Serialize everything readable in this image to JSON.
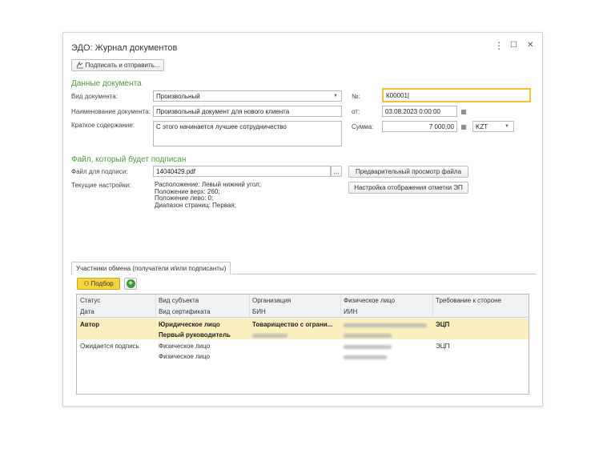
{
  "window": {
    "title": "ЭДО: Журнал документов",
    "more_icon": "⋮",
    "maximize_icon": "☐",
    "close_icon": "✕"
  },
  "toolbar": {
    "sign_send_label": "Подписать и отправить..."
  },
  "doc": {
    "section_title": "Данные документа",
    "type_label": "Вид документа:",
    "type_value": "Произвольный",
    "name_label": "Наименование документа:",
    "name_value": "Произвольный документ для нового клиента",
    "summary_label": "Краткое содержание:",
    "summary_value": "С этого начинается лучшее сотрудничество",
    "number_label": "№:",
    "number_value": "К00001",
    "date_label": "от:",
    "date_value": "03.08.2023 0:00:00",
    "sum_label": "Сумма:",
    "sum_value": "7 000,00",
    "currency_value": "KZT"
  },
  "file": {
    "section_title": "Файл, который будет подписан",
    "file_label": "Файл для подписи:",
    "file_value": "14040429.pdf",
    "browse_label": "...",
    "settings_label": "Текущие настройки:",
    "settings_lines": [
      "Расположение: Левый нижний угол;",
      "Положение верх: 260;",
      "Положение лево: 0;",
      "Диапазон страниц: Первая;"
    ],
    "preview_label": "Предварительный просмотр файла",
    "mark_settings_label": "Настройка отображения отметки ЭП"
  },
  "participants": {
    "tab_label": "Участники обмена (получатели и/или подписанты)",
    "pick_label": "Подбор",
    "add_icon": "+",
    "columns_top": [
      "Статус",
      "Вид субъекта",
      "Организация",
      "Физическое лицо",
      "Требование к стороне"
    ],
    "columns_bottom": [
      "Дата",
      "Вид сертификата",
      "БИН",
      "ИИН"
    ],
    "rows": [
      {
        "status": "Автор",
        "subject": "Юридическое лицо",
        "subject2": "Первый руководитель",
        "org": "Товарищество с ограни...",
        "req": "ЭЦП"
      },
      {
        "status": "Ожидается подпись",
        "subject": "Физическое лицо",
        "subject2": "Физическое лицо",
        "org": "",
        "req": "ЭЦП"
      }
    ]
  }
}
